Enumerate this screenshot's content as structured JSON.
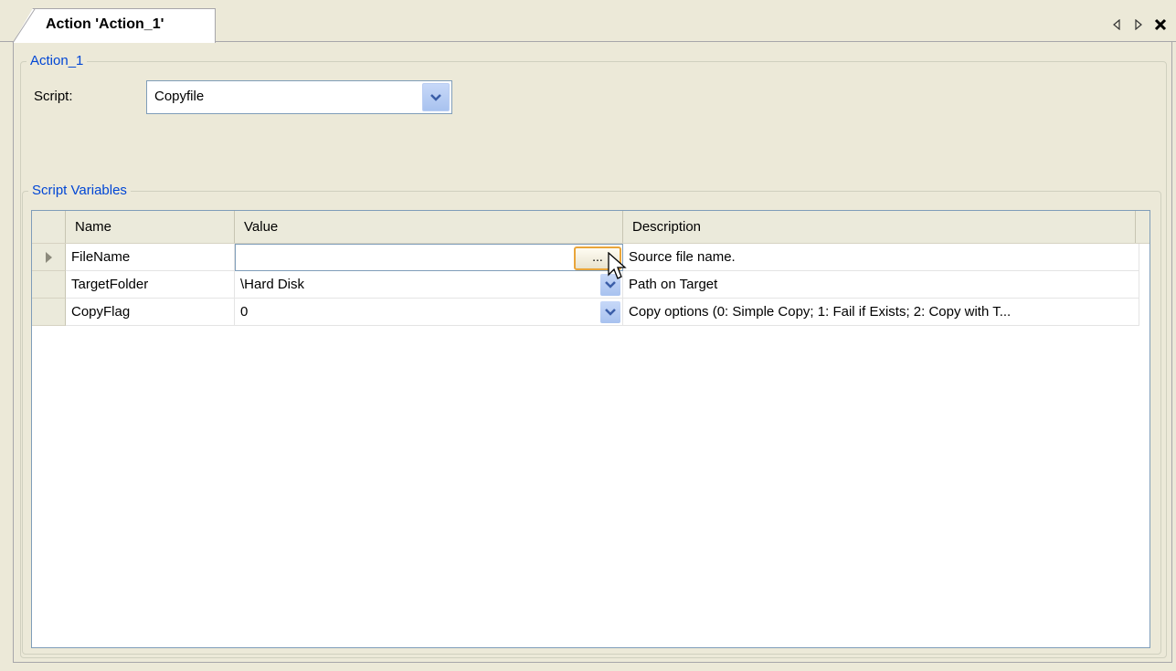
{
  "tab": {
    "title": "Action 'Action_1'"
  },
  "groupbox": {
    "title": "Action_1",
    "script_label": "Script:",
    "script_value": "Copyfile"
  },
  "variables": {
    "title": "Script Variables",
    "columns": [
      "Name",
      "Value",
      "Description"
    ],
    "rows": [
      {
        "name": "FileName",
        "value": "",
        "description": "Source file name.",
        "editor": "browse",
        "browse_label": "..."
      },
      {
        "name": "TargetFolder",
        "value": "\\Hard Disk",
        "description": "Path on Target",
        "editor": "dropdown"
      },
      {
        "name": "CopyFlag",
        "value": "0",
        "description": "Copy options (0: Simple Copy; 1: Fail if Exists; 2: Copy with T...",
        "editor": "dropdown"
      }
    ]
  },
  "colors": {
    "legend": "#0046d5",
    "panel": "#ece9d8",
    "focus": "#e9a53a"
  }
}
